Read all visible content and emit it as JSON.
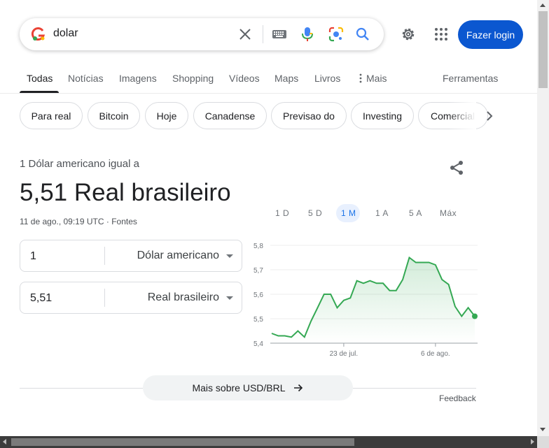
{
  "search": {
    "query": "dolar"
  },
  "header": {
    "login_label": "Fazer login"
  },
  "tabs": [
    {
      "label": "Todas",
      "active": true
    },
    {
      "label": "Notícias"
    },
    {
      "label": "Imagens"
    },
    {
      "label": "Shopping"
    },
    {
      "label": "Vídeos"
    },
    {
      "label": "Maps"
    },
    {
      "label": "Livros"
    },
    {
      "label": "Mais"
    },
    {
      "label": "Ferramentas"
    }
  ],
  "chips": [
    "Para real",
    "Bitcoin",
    "Hoje",
    "Canadense",
    "Previsao do",
    "Investing",
    "Comercial"
  ],
  "converter": {
    "equal_label": "1 Dólar americano igual a",
    "result": "5,51 Real brasileiro",
    "timestamp": "11 de ago., 09:19 UTC",
    "separator": "·",
    "sources_label": "Fontes",
    "from": {
      "value": "1",
      "currency": "Dólar americano"
    },
    "to": {
      "value": "5,51",
      "currency": "Real brasileiro"
    }
  },
  "ranges": [
    {
      "label": "1 D"
    },
    {
      "label": "5 D"
    },
    {
      "label": "1 M",
      "active": true
    },
    {
      "label": "1 A"
    },
    {
      "label": "5 A"
    },
    {
      "label": "Máx"
    }
  ],
  "chart_data": {
    "type": "line",
    "y_ticks": [
      "5,8",
      "5,7",
      "5,6",
      "5,5",
      "5,4"
    ],
    "x_ticks": [
      "23 de jul.",
      "6 de ago."
    ],
    "ylim": [
      5.4,
      5.8
    ],
    "series": [
      {
        "values": [
          5.44,
          5.43,
          5.43,
          5.425,
          5.45,
          5.425,
          5.49,
          5.545,
          5.6,
          5.6,
          5.545,
          5.575,
          5.585,
          5.655,
          5.645,
          5.655,
          5.645,
          5.645,
          5.615,
          5.615,
          5.66,
          5.75,
          5.73,
          5.73,
          5.73,
          5.72,
          5.66,
          5.64,
          5.55,
          5.51,
          5.545,
          5.51
        ]
      }
    ],
    "line_color": "#34a853"
  },
  "more_label": "Mais sobre USD/BRL",
  "feedback_label": "Feedback"
}
